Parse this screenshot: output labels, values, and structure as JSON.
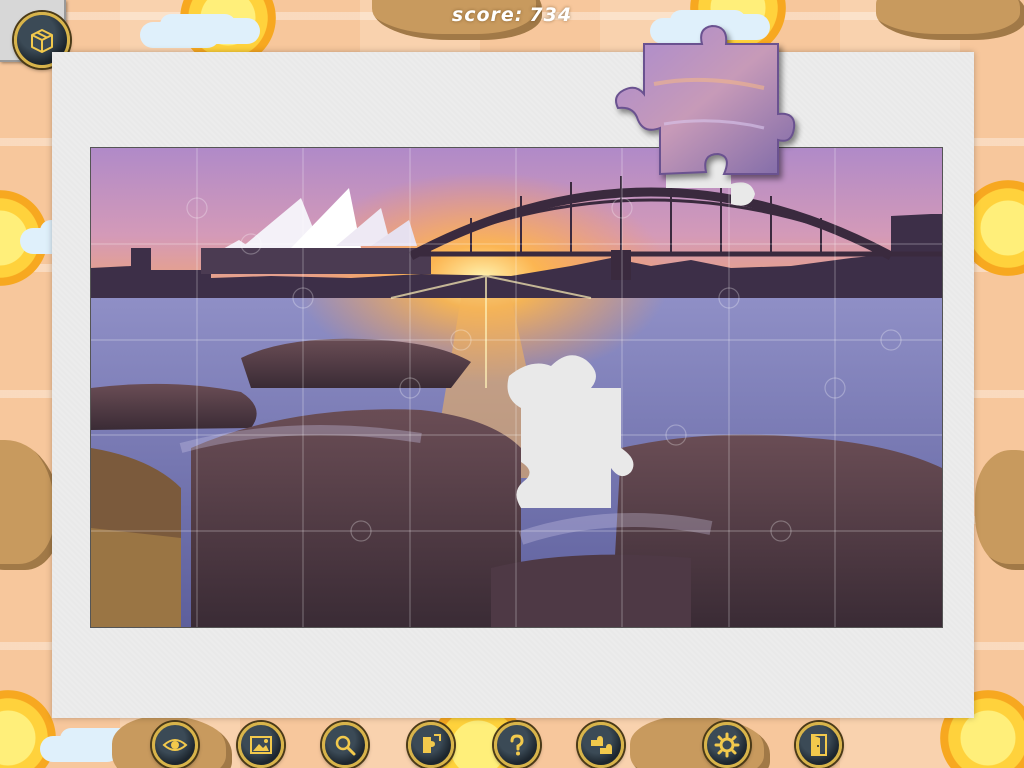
{
  "hud": {
    "score_label": "score:",
    "score_value": "734"
  },
  "menu": {
    "icon": "box-icon"
  },
  "toolbar": {
    "buttons": [
      {
        "icon": "eye-icon"
      },
      {
        "icon": "picture-icon"
      },
      {
        "icon": "magnifier-icon"
      },
      {
        "icon": "puzzle-edges-icon"
      },
      {
        "icon": "question-icon"
      },
      {
        "icon": "puzzle-pieces-icon"
      },
      {
        "icon": "gear-icon"
      },
      {
        "icon": "exit-door-icon"
      }
    ]
  },
  "colors": {
    "button_rim": "#d8b44a",
    "button_face": "#1c252d",
    "icon_gold": "#f2c94c",
    "sky_top": "#b68bc9",
    "sky_glow": "#f5a35a",
    "water": "#6f73b0",
    "rocks": "#5b3f46"
  }
}
